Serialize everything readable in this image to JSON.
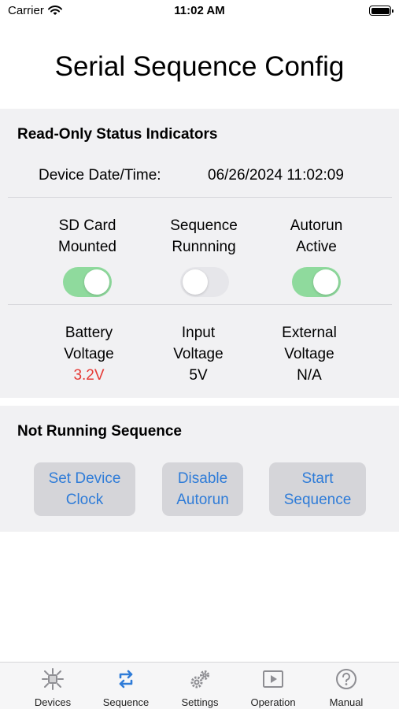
{
  "status_bar": {
    "carrier": "Carrier",
    "time": "11:02 AM"
  },
  "title": "Serial Sequence Config",
  "status_panel": {
    "heading": "Read-Only Status Indicators",
    "datetime_label": "Device Date/Time:",
    "datetime_value": "06/26/2024 11:02:09",
    "toggles": [
      {
        "line1": "SD Card",
        "line2": "Mounted",
        "on": true
      },
      {
        "line1": "Sequence",
        "line2": "Runnning",
        "on": false
      },
      {
        "line1": "Autorun",
        "line2": "Active",
        "on": true
      }
    ],
    "voltages": [
      {
        "line1": "Battery",
        "line2": "Voltage",
        "value": "3.2V",
        "value_color": "#e53935"
      },
      {
        "line1": "Input",
        "line2": "Voltage",
        "value": "5V"
      },
      {
        "line1": "External",
        "line2": "Voltage",
        "value": "N/A"
      }
    ]
  },
  "action_panel": {
    "heading": "Not Running Sequence",
    "buttons": [
      {
        "line1": "Set Device",
        "line2": "Clock"
      },
      {
        "line1": "Disable",
        "line2": "Autorun"
      },
      {
        "line1": "Start",
        "line2": "Sequence"
      }
    ]
  },
  "tab_bar": {
    "active_index": 1,
    "accent_color": "#2f7cd8",
    "inactive_icon_color": "#8e8e93",
    "tabs": [
      {
        "label": "Devices",
        "icon": "devices-icon"
      },
      {
        "label": "Sequence",
        "icon": "sequence-icon"
      },
      {
        "label": "Settings",
        "icon": "gears-icon"
      },
      {
        "label": "Operation",
        "icon": "play-icon"
      },
      {
        "label": "Manual",
        "icon": "help-icon"
      }
    ]
  },
  "colors": {
    "toggle_on": "#8fda9d",
    "toggle_off": "#e6e6ea",
    "button_text": "#2f7cd8",
    "panel_background": "#f1f1f3"
  }
}
